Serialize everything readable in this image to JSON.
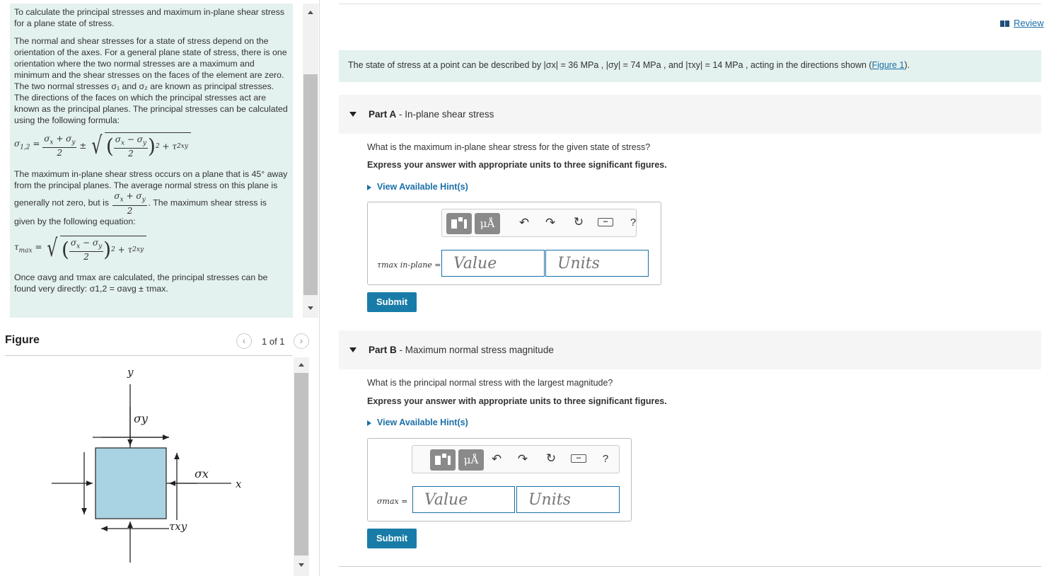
{
  "intro": {
    "para1": "To calculate the principal stresses and maximum in-plane shear stress for a plane state of stress.",
    "para2": "The normal and shear stresses for a state of stress depend on the orientation of the axes. For a general plane state of stress, there is one orientation where the two normal stresses are a maximum and minimum and the shear stresses on the faces of the element are zero. The two normal stresses σ₁ and σ₂ are known as principal stresses. The directions of the faces on which the principal stresses act are known as the principal planes. The principal stresses can be calculated using the following formula:",
    "para3a": "The maximum in-plane shear stress occurs on a plane that is 45° away from the principal planes. The average normal stress on this plane is generally not zero, but is",
    "para3b": ". The maximum shear stress is given by the following equation:",
    "para4": "Once σavg and τmax are calculated, the principal stresses can be found very directly: σ1,2 = σavg ± τmax."
  },
  "figure": {
    "title": "Figure",
    "count": "1 of 1",
    "labels": {
      "y": "y",
      "x": "x",
      "sigma_y": "σy",
      "sigma_x": "σx",
      "tau_xy": "τxy"
    }
  },
  "review": {
    "label": "Review"
  },
  "problem": {
    "text": "The state of stress at a point can be described by |σx| = 36 MPa , |σy| = 74 MPa , and |τxy| = 14 MPa , acting in the directions shown (",
    "link": "Figure 1",
    "end": ")."
  },
  "parts": [
    {
      "label": "Part A",
      "title": "In-plane shear stress",
      "question": "What is the maximum in-plane shear stress for the given state of stress?",
      "instruction": "Express your answer with appropriate units to three significant figures.",
      "hint": "View Available Hint(s)",
      "answer_label": "τmax in-plane =",
      "value_placeholder": "Value",
      "units_placeholder": "Units",
      "submit": "Submit"
    },
    {
      "label": "Part B",
      "title": "Maximum normal stress magnitude",
      "question": "What is the principal normal stress with the largest magnitude?",
      "instruction": "Express your answer with appropriate units to three significant figures.",
      "hint": "View Available Hint(s)",
      "answer_label": "σmax =",
      "value_placeholder": "Value",
      "units_placeholder": "Units",
      "submit": "Submit"
    }
  ],
  "toolbar": {
    "mu_label": "μÅ",
    "help": "?"
  },
  "colors": {
    "accent": "#197ca8",
    "panel": "#e3f1ef",
    "element_fill": "#a9d3e3"
  }
}
